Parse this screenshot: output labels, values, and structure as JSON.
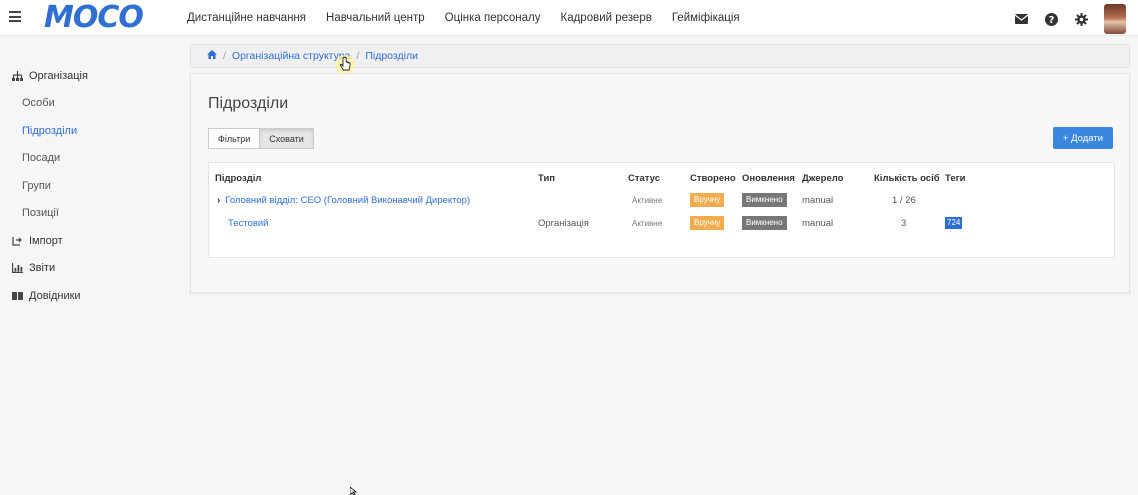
{
  "header": {
    "logo": "MOCO",
    "nav": [
      "Дистанційне навчання",
      "Навчальний центр",
      "Оцінка персоналу",
      "Кадровий резерв",
      "Гейміфікація"
    ]
  },
  "sidebar": {
    "items": [
      {
        "label": "Організація",
        "icon": "org-tree-icon",
        "level": 0
      },
      {
        "label": "Особи",
        "level": 1
      },
      {
        "label": "Підрозділи",
        "level": 1,
        "active": true
      },
      {
        "label": "Посади",
        "level": 1
      },
      {
        "label": "Групи",
        "level": 1
      },
      {
        "label": "Позиції",
        "level": 1
      },
      {
        "label": "Імпорт",
        "icon": "import-icon",
        "level": 0
      },
      {
        "label": "Звіти",
        "icon": "reports-icon",
        "level": 0
      },
      {
        "label": "Довідники",
        "icon": "book-icon",
        "level": 0
      }
    ]
  },
  "breadcrumb": {
    "home_icon": "home-icon",
    "items": [
      "Організаційна структура",
      "Підрозділи"
    ],
    "separator": "/"
  },
  "page": {
    "title": "Підрозділи",
    "filters_label": "Фільтри",
    "hide_label": "Сховати",
    "add_label": "+ Додати"
  },
  "table": {
    "headers": [
      "Підрозділ",
      "Тип",
      "Статус",
      "Створено",
      "Оновлення",
      "Джерело",
      "Кількість осіб",
      "Теги"
    ],
    "rows": [
      {
        "name": "Головний відділ: CEO (Головний Виконавчий Директор)",
        "expandable": true,
        "type": "",
        "status": "Активне",
        "created": "Вручну",
        "updated": "Вимкнено",
        "source": "manual",
        "count": "1 / 26",
        "tag": ""
      },
      {
        "name": "Тестовий",
        "expandable": false,
        "type": "Організація",
        "status": "Активне",
        "created": "Вручну",
        "updated": "Вимкнено",
        "source": "manual",
        "count": "3",
        "tag": "724"
      }
    ]
  },
  "colors": {
    "brand": "#2f6ed3",
    "add_button": "#3a87e0",
    "created_badge": "#f0ad4e",
    "updated_badge": "#777777"
  }
}
